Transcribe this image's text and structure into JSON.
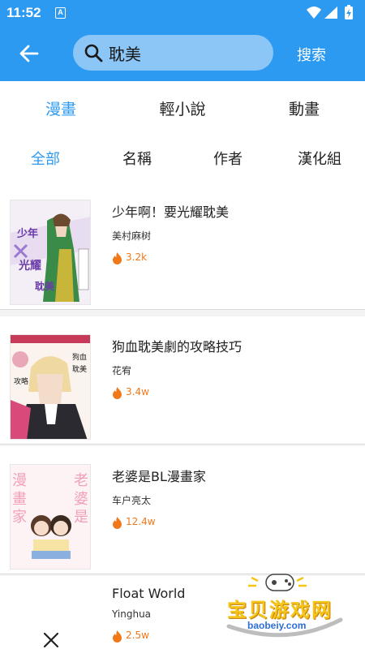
{
  "status": {
    "time": "11:52",
    "notif_letter": "A"
  },
  "header": {
    "search_value": "耽美",
    "search_button": "搜索"
  },
  "category_tabs": [
    {
      "label": "漫畫",
      "active": true
    },
    {
      "label": "輕小說",
      "active": false
    },
    {
      "label": "動畫",
      "active": false
    }
  ],
  "filter_tabs": [
    {
      "label": "全部",
      "active": true
    },
    {
      "label": "名稱",
      "active": false
    },
    {
      "label": "作者",
      "active": false
    },
    {
      "label": "漢化組",
      "active": false
    }
  ],
  "results": [
    {
      "title": "少年啊！要光耀耽美",
      "author": "美村麻树",
      "heat": "3.2k"
    },
    {
      "title": "狗血耽美劇的攻略技巧",
      "author": "花宥",
      "heat": "3.4w"
    },
    {
      "title": "老婆是BL漫畫家",
      "author": "车户亮太",
      "heat": "12.4w"
    },
    {
      "title": "Float World",
      "author": "Yinghua",
      "heat": "2.5w"
    }
  ],
  "watermark": {
    "line1": "宝贝游戏网",
    "line2": "baobeiy.com"
  },
  "colors": {
    "primary": "#2d9af1",
    "search_bg": "#8cc6f6",
    "heat": "#f07818"
  }
}
